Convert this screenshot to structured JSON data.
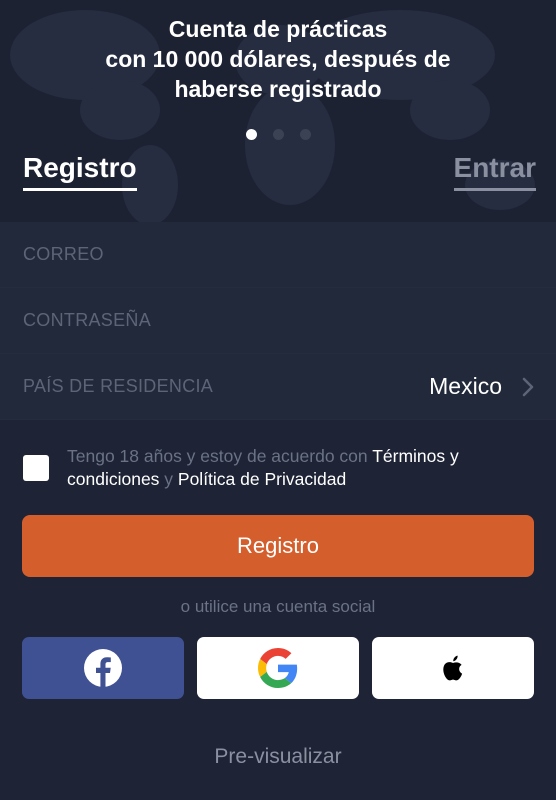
{
  "promo": {
    "line1": "Cuenta de prácticas",
    "line2": "con 10 000 dólares, después de",
    "line3": "haberse registrado"
  },
  "carousel": {
    "count": 3,
    "active_index": 0
  },
  "tabs": {
    "register": "Registro",
    "login": "Entrar",
    "active": "register"
  },
  "form": {
    "email_placeholder": "CORREO",
    "password_placeholder": "CONTRASEÑA",
    "country_label": "PAÍS DE RESIDENCIA",
    "country_value": "Mexico"
  },
  "terms": {
    "text1": "Tengo 18 años y estoy de acuerdo con ",
    "link1": "Términos y condiciones",
    "text2": " y ",
    "link2": "Política de Privacidad",
    "checked": false
  },
  "register_button": "Registro",
  "social": {
    "caption": "o utilice una cuenta social",
    "buttons": [
      "facebook-icon",
      "google-icon",
      "apple-icon"
    ]
  },
  "preview_link": "Pre-visualizar",
  "colors": {
    "background": "#1e2436",
    "accent": "#d55e2d",
    "facebook": "#3f5193",
    "muted_text": "#6b7286"
  }
}
